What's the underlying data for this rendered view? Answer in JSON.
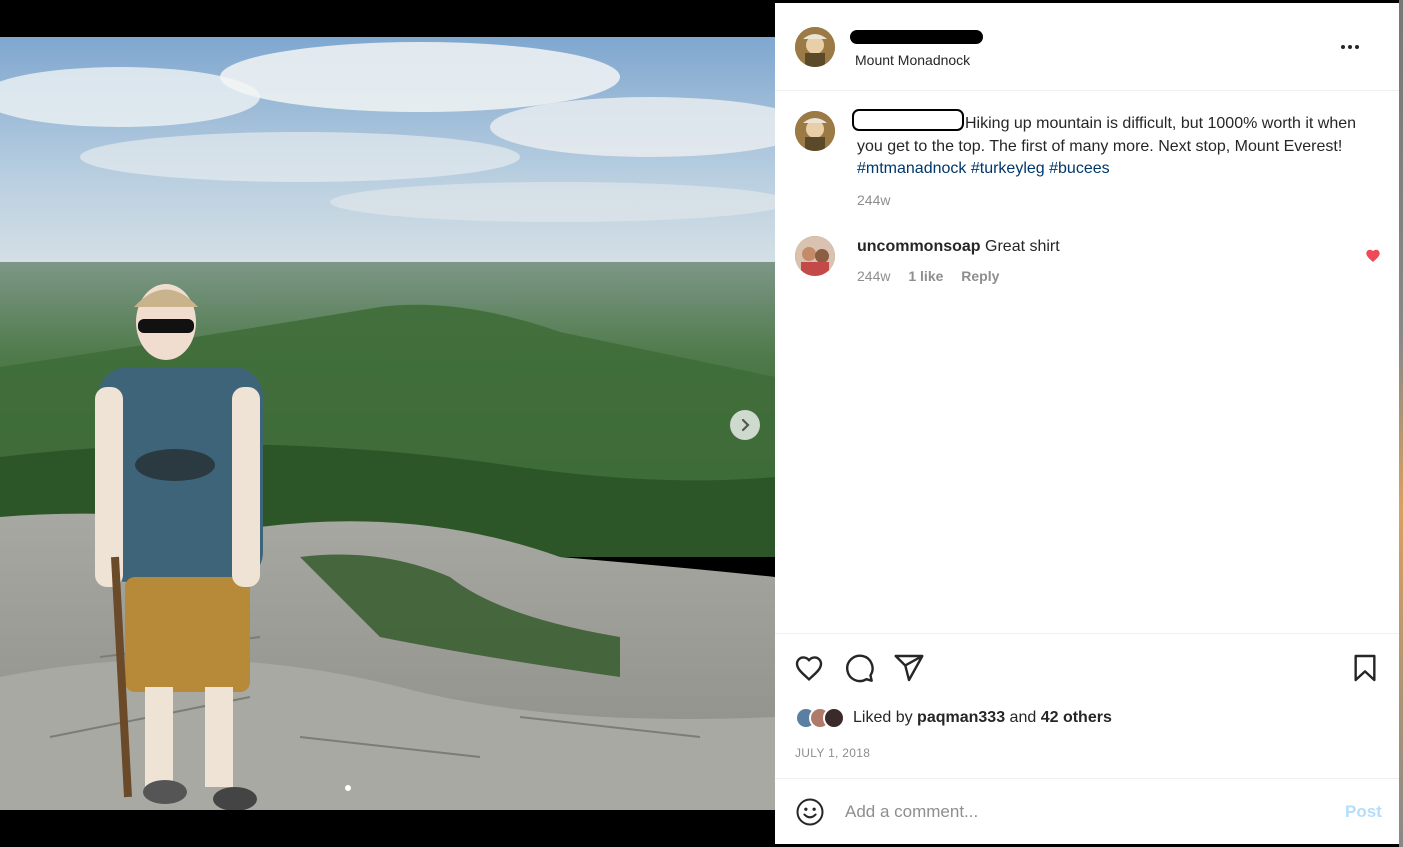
{
  "post": {
    "location": "Mount Monadnock",
    "caption_text": "Hiking up mountain is difficult, but 1000% worth it when you get to the top. The first of many more. Next stop, Mount Everest!",
    "hashtags": [
      "#mtmanadnock",
      "#turkeyleg",
      "#bucees"
    ],
    "caption_age": "244w"
  },
  "comments": [
    {
      "username": "uncommonsoap",
      "text": "Great shirt",
      "age": "244w",
      "likes": "1 like",
      "reply_label": "Reply"
    }
  ],
  "likes": {
    "prefix": "Liked by",
    "user": "paqman333",
    "joiner": "and",
    "others": "42 others"
  },
  "date": "JULY 1, 2018",
  "comment_box": {
    "placeholder": "Add a comment...",
    "post_label": "Post"
  },
  "icons": [
    "more-options-icon",
    "heart-icon",
    "comment-icon",
    "share-icon",
    "bookmark-icon",
    "emoji-icon",
    "chevron-right-icon",
    "liked-heart-icon"
  ],
  "colors": {
    "hashtag": "#00376b",
    "muted": "#8e8e8e",
    "post_button": "#b2dffc",
    "liked_heart": "#ed4956"
  }
}
